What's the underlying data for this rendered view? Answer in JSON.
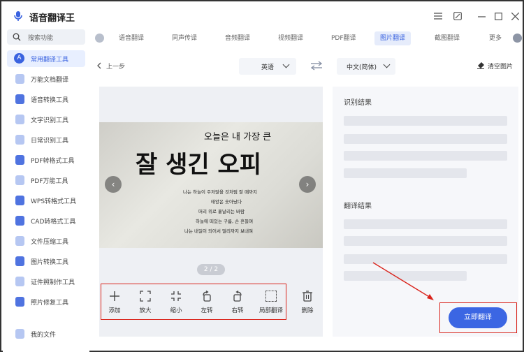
{
  "app": {
    "title": "语音翻译王"
  },
  "sidebar": {
    "search_label": "搜索功能",
    "items": [
      {
        "label": "常用翻译工具"
      },
      {
        "label": "万能文档翻译"
      },
      {
        "label": "语音转换工具"
      },
      {
        "label": "文字识别工具"
      },
      {
        "label": "日常识别工具"
      },
      {
        "label": "PDF转格式工具"
      },
      {
        "label": "PDF万能工具"
      },
      {
        "label": "WPS转格式工具"
      },
      {
        "label": "CAD转格式工具"
      },
      {
        "label": "文件压缩工具"
      },
      {
        "label": "图片转换工具"
      },
      {
        "label": "证件照制作工具"
      },
      {
        "label": "照片修复工具"
      }
    ],
    "my_files": "我的文件"
  },
  "tabs": {
    "items": [
      {
        "label": "语音翻译"
      },
      {
        "label": "同声传译"
      },
      {
        "label": "音频翻译"
      },
      {
        "label": "视频翻译"
      },
      {
        "label": "PDF翻译"
      },
      {
        "label": "图片翻译"
      },
      {
        "label": "截图翻译"
      }
    ],
    "more": "更多"
  },
  "toolbar": {
    "back": "上一步",
    "source_lang": "英语",
    "target_lang": "中文(简体)",
    "clear": "清空图片"
  },
  "image": {
    "handwriting_line1": "오늘은 내 가장 큰",
    "handwriting_line2": "잘 생긴 오피",
    "small_lines": [
      "나는 하늘이 주저않을 것처럼 잘 때까지",
      "태양은 솟아났다",
      "머리 위로 흩날리는 바람",
      "하늘에 떠있는 구름, 손 흔들며",
      "나는 내일이 되어서 멀리까지 보내며"
    ],
    "pager": "2 / 2"
  },
  "tools": [
    {
      "label": "添加"
    },
    {
      "label": "放大"
    },
    {
      "label": "缩小"
    },
    {
      "label": "左转"
    },
    {
      "label": "右转"
    },
    {
      "label": "局部翻译"
    },
    {
      "label": "删除"
    }
  ],
  "results": {
    "recognition_title": "识别结果",
    "translation_title": "翻译结果",
    "translate_button": "立即翻译"
  },
  "colors": {
    "accent": "#3b66e3",
    "highlight": "#d9241c"
  }
}
